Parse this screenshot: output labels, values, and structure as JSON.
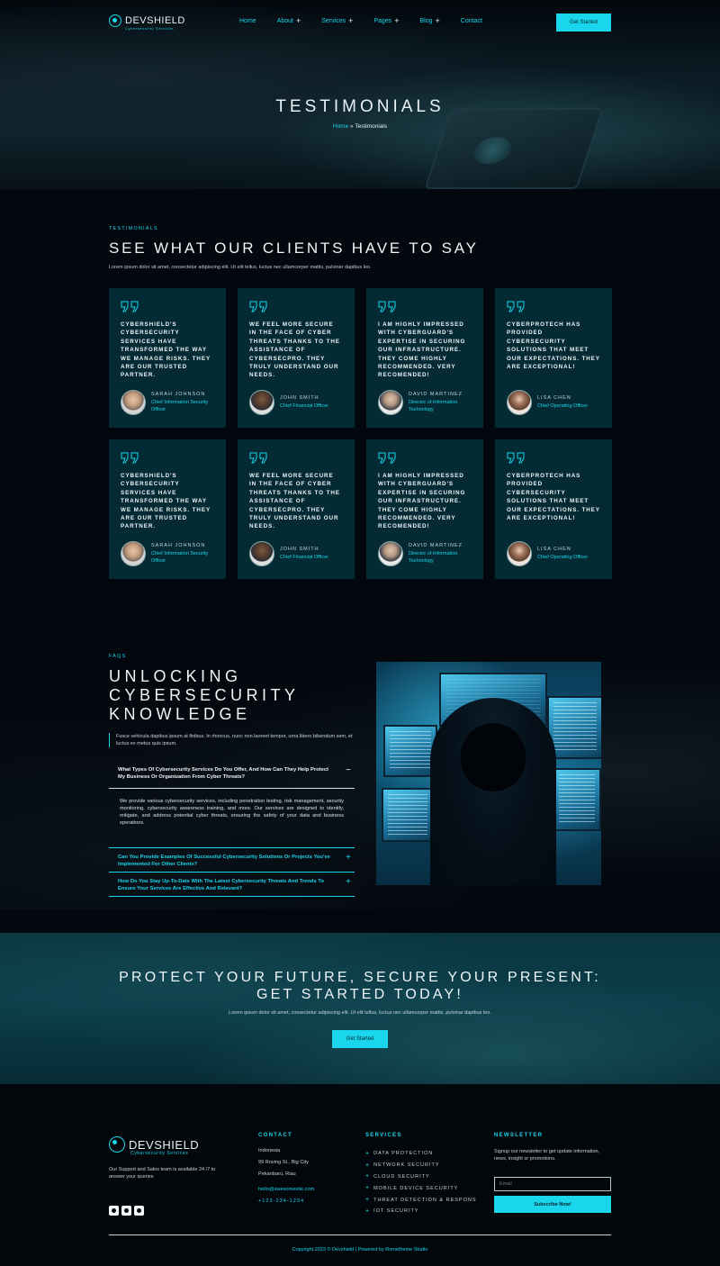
{
  "nav": {
    "logo_text": "DEVSHIELD",
    "logo_subtitle": "Cybersecurity Services",
    "items": [
      {
        "label": "Home",
        "has_plus": false
      },
      {
        "label": "About",
        "has_plus": true
      },
      {
        "label": "Services",
        "has_plus": true
      },
      {
        "label": "Pages",
        "has_plus": true
      },
      {
        "label": "Blog",
        "has_plus": true
      },
      {
        "label": "Contact",
        "has_plus": false
      }
    ],
    "plus_icon": "+",
    "cta_label": "Get Started"
  },
  "hero": {
    "title": "TESTIMONIALS",
    "breadcrumb_home": "Home",
    "breadcrumb_sep": "»",
    "breadcrumb_current": "Testimonials"
  },
  "testimonials": {
    "tag": "TESTIMONIALS",
    "title": "SEE WHAT OUR CLIENTS HAVE TO SAY",
    "description": "Lorem ipsum dolor sit amet, consectetur adipiscing elit. Ut elit tellus, luctus nec ullamcorper mattis, pulvinar dapibus leo.",
    "cards": [
      {
        "quote": "CYBERSHIELD'S CYBERSECURITY SERVICES HAVE TRANSFORMED THE WAY WE MANAGE RISKS. THEY ARE OUR TRUSTED PARTNER.",
        "name": "SARAH JOHNSON",
        "role": "Chief Information Security Officer",
        "avatar": "f"
      },
      {
        "quote": "WE FEEL MORE SECURE IN THE FACE OF CYBER THREATS THANKS TO THE ASSISTANCE OF CYBERSECPRO. THEY TRULY UNDERSTAND OUR NEEDS.",
        "name": "JOHN SMITH",
        "role": "Chief Financial Officer",
        "avatar": "m"
      },
      {
        "quote": "I AM HIGHLY IMPRESSED WITH CYBERGUARD'S EXPERTISE IN SECURING OUR INFRASTRUCTURE. THEY COME HIGHLY RECOMMENDED. VERY RECOMENDED!",
        "name": "DAVID MARTINEZ",
        "role": "Director of Information Technology",
        "avatar": "d"
      },
      {
        "quote": "CYBERPROTECH HAS PROVIDED CYBERSECURITY SOLUTIONS THAT MEET OUR EXPECTATIONS. THEY ARE EXCEPTIONAL!",
        "name": "LISA CHEN",
        "role": "Chief Operating Officer",
        "avatar": "l"
      },
      {
        "quote": "CYBERSHIELD'S CYBERSECURITY SERVICES HAVE TRANSFORMED THE WAY WE MANAGE RISKS. THEY ARE OUR TRUSTED PARTNER.",
        "name": "SARAH JOHNSON",
        "role": "Chief Information Security Officer",
        "avatar": "f"
      },
      {
        "quote": "WE FEEL MORE SECURE IN THE FACE OF CYBER THREATS THANKS TO THE ASSISTANCE OF CYBERSECPRO. THEY TRULY UNDERSTAND OUR NEEDS.",
        "name": "JOHN SMITH",
        "role": "Chief Financial Officer",
        "avatar": "m"
      },
      {
        "quote": "I AM HIGHLY IMPRESSED WITH CYBERGUARD'S EXPERTISE IN SECURING OUR INFRASTRUCTURE. THEY COME HIGHLY RECOMMENDED. VERY RECOMENDED!",
        "name": "DAVID MARTINEZ",
        "role": "Director of Information Technology",
        "avatar": "d"
      },
      {
        "quote": "CYBERPROTECH HAS PROVIDED CYBERSECURITY SOLUTIONS THAT MEET OUR EXPECTATIONS. THEY ARE EXCEPTIONAL!",
        "name": "LISA CHEN",
        "role": "Chief Operating Officer",
        "avatar": "l"
      }
    ]
  },
  "faq": {
    "tag": "FAQS",
    "title": "UNLOCKING CYBERSECURITY KNOWLEDGE",
    "note": "Fusce vehicula dapibus ipsum at finibus. In rhoncus, nunc non laoreet tempor, urna libero bibendum sem, et luctus ex metus quis ipsum.",
    "items": [
      {
        "question": "What Types Of Cybersecurity Services Do You Offer, And How Can They Help Protect My Business Or Organization From Cyber Threats?",
        "sign": "−",
        "answer": "We provide various cybersecurity services, including penetration testing, risk management, security monitoring, cybersecurity awareness training, and more. Our services are designed to identify, mitigate, and address potential cyber threats, ensuring the safety of your data and business operations."
      },
      {
        "question": "Can You Provide Examples Of Successful Cybersecurity Solutions Or Projects You've Implemented For Other Clients?",
        "sign": "+"
      },
      {
        "question": "How Do You Stay Up-To-Date With The Latest Cybersecurity Threats And Trends To Ensure Your Services Are Effective And Relevant?",
        "sign": "+"
      }
    ]
  },
  "cta": {
    "title_line1": "PROTECT YOUR FUTURE, SECURE YOUR PRESENT:",
    "title_line2": "GET STARTED TODAY!",
    "description": "Lorem ipsum dolor sit amet, consectetur adipiscing elit. Ut elit tellus, luctus nec ullamcorper mattis, pulvinar dapibus leo.",
    "button": "Get Started"
  },
  "footer": {
    "logo_text": "DEVSHIELD",
    "logo_subtitle": "Cybersecurity Services",
    "about": "Our Support and Sales team is available 24 /7 to answer your queries",
    "socials": [
      "facebook-icon",
      "twitter-icon",
      "youtube-icon"
    ],
    "contact_heading": "CONTACT",
    "contact_lines": [
      "Indonesia",
      "99 Roving St., Big City",
      "Pekanbaru, Riau"
    ],
    "email": "hello@awesomesite.com",
    "phone": "+123-234-1234",
    "services_heading": "SERVICES",
    "services": [
      "DATA PROTECTION",
      "NETWORK SECURITY",
      "CLOUD SECURITY",
      "MOBILE DEVICE SECURITY",
      "THREAT DETECTION & RESPONS",
      "IOT SECURITY"
    ],
    "newsletter_heading": "NEWSLETTER",
    "newsletter_text": "Signup our newsletter to get update information, news, insight or promotions.",
    "email_placeholder": "Email",
    "subscribe_label": "Subscribe Now!",
    "copyright": "Copyright 2023 © Devshield | Powered by Rometheme Studio"
  },
  "colors": {
    "accent": "#19d6ec",
    "card_bg": "#042a33",
    "page_bg": "#03080e"
  }
}
